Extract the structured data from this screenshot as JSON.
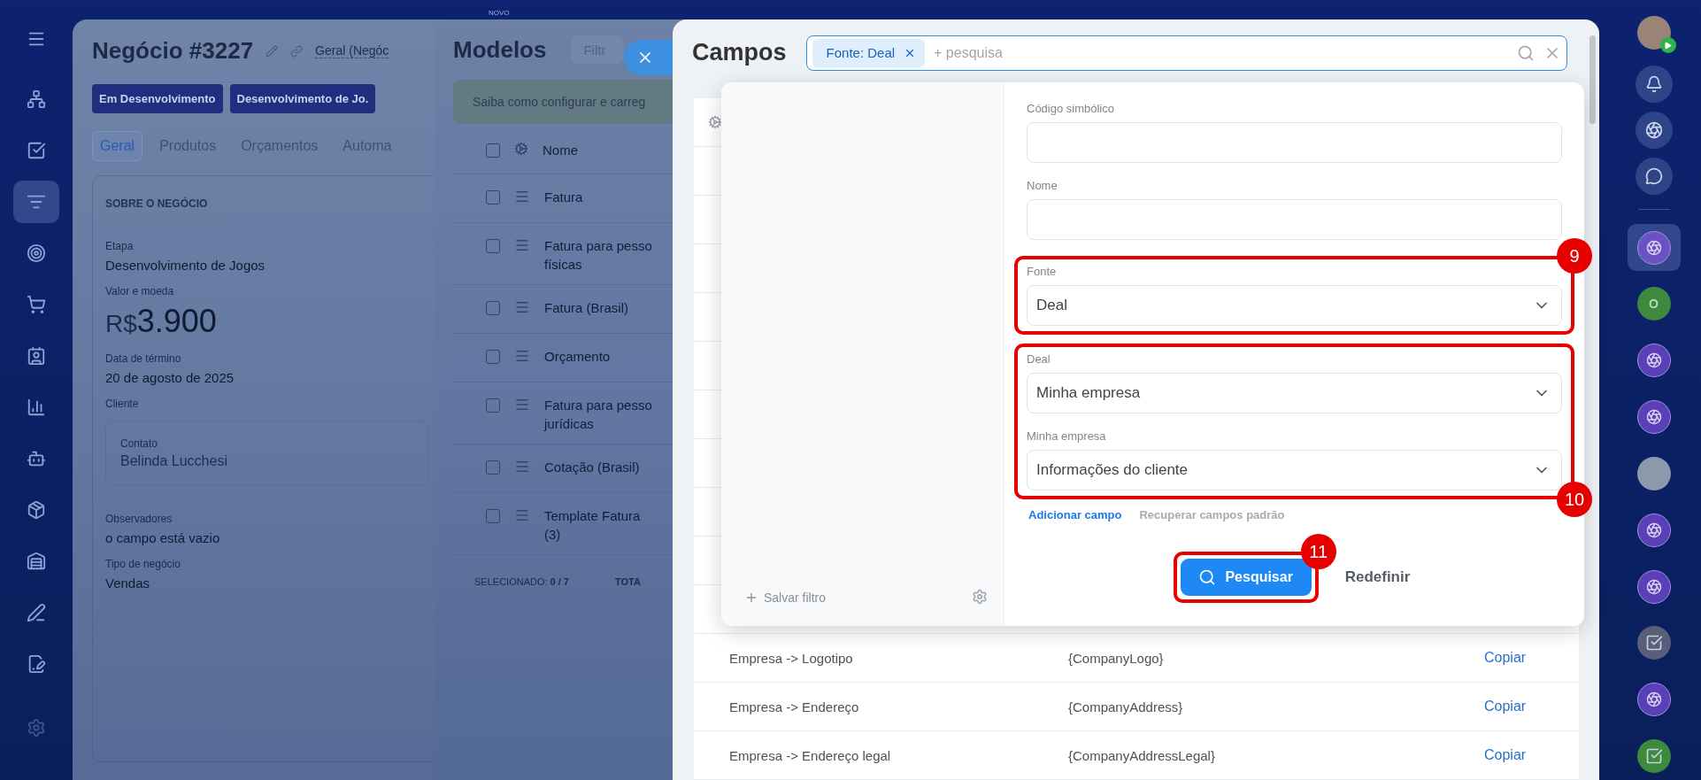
{
  "left_nav": {
    "items": [
      {
        "selected": false
      },
      {
        "selected": false
      },
      {
        "selected": true
      },
      {
        "selected": false
      },
      {
        "selected": false
      },
      {
        "selected": false
      },
      {
        "selected": false
      },
      {
        "selected": false
      },
      {
        "selected": false
      },
      {
        "selected": false
      },
      {
        "selected": false
      },
      {
        "selected": false
      },
      {
        "selected": false
      }
    ]
  },
  "top_label": "NOVO",
  "deal_panel": {
    "title": "Negócio #3227",
    "category": "Geral (Negóc",
    "stages": [
      "Em Desenvolvimento",
      "Desenvolvimento de Jo."
    ],
    "tabs": [
      {
        "label": "Geral",
        "selected": true
      },
      {
        "label": "Produtos",
        "selected": false
      },
      {
        "label": "Orçamentos",
        "selected": false
      },
      {
        "label": "Automa",
        "selected": false
      }
    ],
    "section_title": "SOBRE O NEGÓCIO",
    "fields": [
      {
        "kind": "text",
        "label": "Etapa",
        "value": "Desenvolvimento de Jogos"
      },
      {
        "kind": "money",
        "label": "Valor e moeda",
        "currency": "R$",
        "value": "3.900"
      },
      {
        "kind": "text",
        "label": "Data de término",
        "value": "20 de agosto de 2025"
      },
      {
        "kind": "client",
        "label": "Cliente",
        "contact_label": "Contato",
        "value": "Belinda Lucchesi"
      },
      {
        "kind": "text",
        "label": "Observadores",
        "value": "o campo está vazio"
      },
      {
        "kind": "text",
        "label": "Tipo de negócio",
        "value": "Vendas"
      }
    ]
  },
  "templates_panel": {
    "title": "Modelos",
    "filter_placeholder": "Filtr",
    "header_checked": false,
    "banner": "Saiba como configurar e carreg",
    "column": "Nome",
    "rows": [
      {
        "name": "Fatura",
        "checked": false
      },
      {
        "name": "Fatura para pesso\nfísicas",
        "checked": false
      },
      {
        "name": "Fatura (Brasil)",
        "checked": false
      },
      {
        "name": "Orçamento",
        "checked": false
      },
      {
        "name": "Fatura para pesso\njurídicas",
        "checked": false
      },
      {
        "name": "Cotação (Brasil)",
        "checked": false
      },
      {
        "name": "Template Fatura\n(3)",
        "checked": false
      }
    ],
    "selected_count": "SELECIONADO: **0 / 7**",
    "total": "TOTA"
  },
  "fields_panel": {
    "title": "Campos",
    "search": {
      "chip": "Fonte: Deal",
      "placeholder": "+ pesquisa"
    },
    "rows": [
      {
        "name": "Empresa -> Logotipo",
        "code": "{CompanyLogo}",
        "action": "Copiar"
      },
      {
        "name": "Empresa -> Endereço",
        "code": "{CompanyAddress}",
        "action": "Copiar"
      },
      {
        "name": "Empresa -> Endereço legal",
        "code": "{CompanyAddressLegal}",
        "action": "Copiar"
      }
    ]
  },
  "filter_popup": {
    "save_filter": "Salvar filtro",
    "field_groups": [
      {
        "fields": [
          {
            "kind": "input",
            "label": "Código simbólico"
          },
          {
            "kind": "input",
            "label": "Nome"
          }
        ]
      },
      {
        "annotation": {
          "label": "9"
        },
        "fields": [
          {
            "kind": "select",
            "label": "Fonte",
            "value": "Deal"
          }
        ]
      },
      {
        "annotation": {
          "label": "10"
        },
        "fields": [
          {
            "kind": "select",
            "label": "Deal",
            "value": "Minha empresa"
          },
          {
            "kind": "select",
            "label": "Minha empresa",
            "value": "Informações do cliente"
          }
        ]
      }
    ],
    "links": [
      {
        "label": "Adicionar campo",
        "disabled": false
      },
      {
        "label": "Recuperar campos padrão",
        "disabled": true
      }
    ],
    "search_button": {
      "label": "Pesquisar",
      "annotation": {
        "label": "11"
      }
    },
    "reset_button": "Redefinir"
  },
  "right_bar": {
    "apps": [
      {
        "kind": "app",
        "color": "#6b52c4",
        "selected": true
      },
      {
        "kind": "letter",
        "label": "O",
        "color": "#3d8a3e",
        "selected": false
      },
      {
        "kind": "app",
        "color": "#5a40b8",
        "selected": false
      },
      {
        "kind": "app",
        "color": "#5a40b8",
        "selected": false
      },
      {
        "kind": "photo",
        "selected": false
      },
      {
        "kind": "app",
        "color": "#5a40b8",
        "selected": false
      },
      {
        "kind": "app",
        "color": "#5a40b8",
        "selected": false
      },
      {
        "kind": "task",
        "color": "#5a5e78",
        "selected": false
      },
      {
        "kind": "app",
        "color": "#5a40b8",
        "selected": false
      },
      {
        "kind": "task",
        "color": "#3d8a3e",
        "selected": false
      }
    ]
  }
}
